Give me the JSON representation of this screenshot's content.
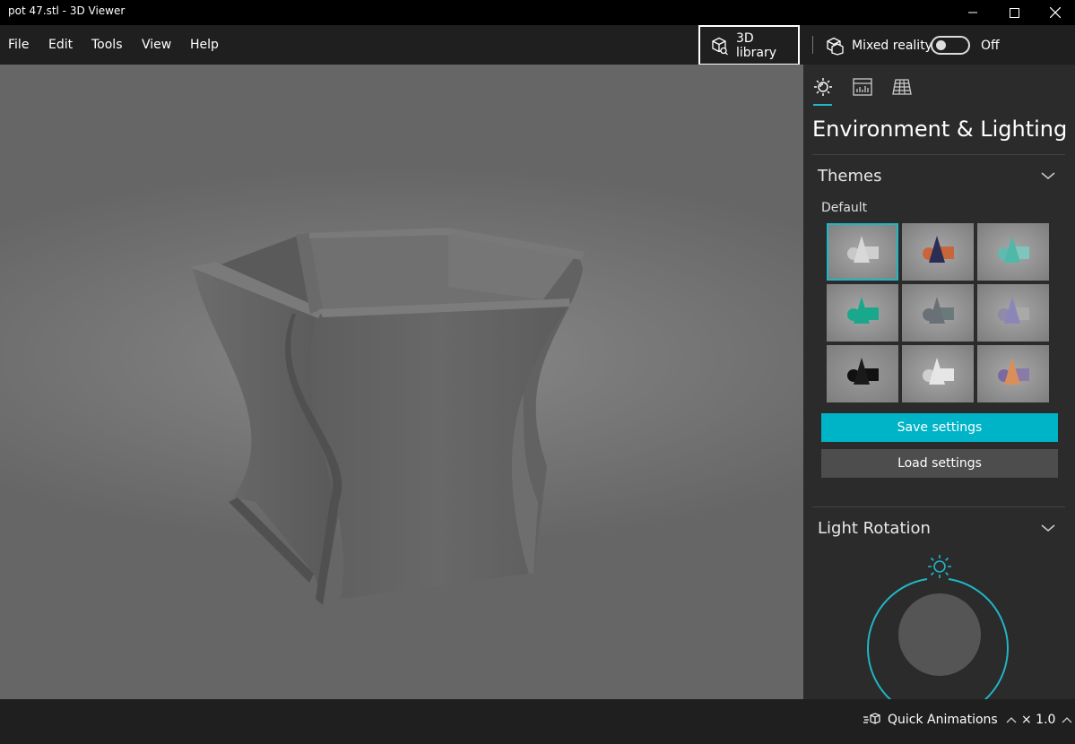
{
  "window": {
    "title": "pot 47.stl - 3D Viewer"
  },
  "menu": {
    "items": [
      "File",
      "Edit",
      "Tools",
      "View",
      "Help"
    ]
  },
  "toolbar": {
    "library_label": "3D library",
    "mixed_reality_label": "Mixed reality",
    "mixed_reality_state": "Off"
  },
  "panel": {
    "tabs": [
      "lighting-icon",
      "stats-icon",
      "grid-icon"
    ],
    "title": "Environment & Lighting",
    "themes": {
      "header": "Themes",
      "selected_label": "Default",
      "items": [
        {
          "name": "theme-default",
          "cone": "#d8d8d8",
          "box": "#cfcfcf",
          "sphere": "#c8c8c8",
          "selected": true
        },
        {
          "name": "theme-2",
          "cone": "#2a2d55",
          "box": "#c8653a",
          "sphere": "#c8653a",
          "selected": false
        },
        {
          "name": "theme-3",
          "cone": "#4fb8a8",
          "box": "#7ec6bd",
          "sphere": "#62b9b0",
          "selected": false
        },
        {
          "name": "theme-4",
          "cone": "#1aa88d",
          "box": "#1aa88d",
          "sphere": "#1aa88d",
          "selected": false
        },
        {
          "name": "theme-5",
          "cone": "#6a7176",
          "box": "#6a7a7a",
          "sphere": "#6a7176",
          "selected": false
        },
        {
          "name": "theme-6",
          "cone": "#8a87b8",
          "box": "#a9a9a9",
          "sphere": "#8e8aa8",
          "selected": false
        },
        {
          "name": "theme-7",
          "cone": "#1a1a1a",
          "box": "#111111",
          "sphere": "#111111",
          "selected": false
        },
        {
          "name": "theme-8",
          "cone": "#e6e6e6",
          "box": "#e6e6e6",
          "sphere": "#cfcfcf",
          "selected": false
        },
        {
          "name": "theme-9",
          "cone": "#d98f5a",
          "box": "#8a7aa8",
          "sphere": "#7a6aa0",
          "selected": false
        }
      ],
      "save_label": "Save settings",
      "load_label": "Load settings"
    },
    "light_rotation": {
      "header": "Light Rotation"
    }
  },
  "bottombar": {
    "quick_animations_label": "Quick Animations",
    "speed_label": "× 1.0"
  },
  "colors": {
    "accent": "#1fb7c6",
    "save_button": "#00b4c8"
  }
}
